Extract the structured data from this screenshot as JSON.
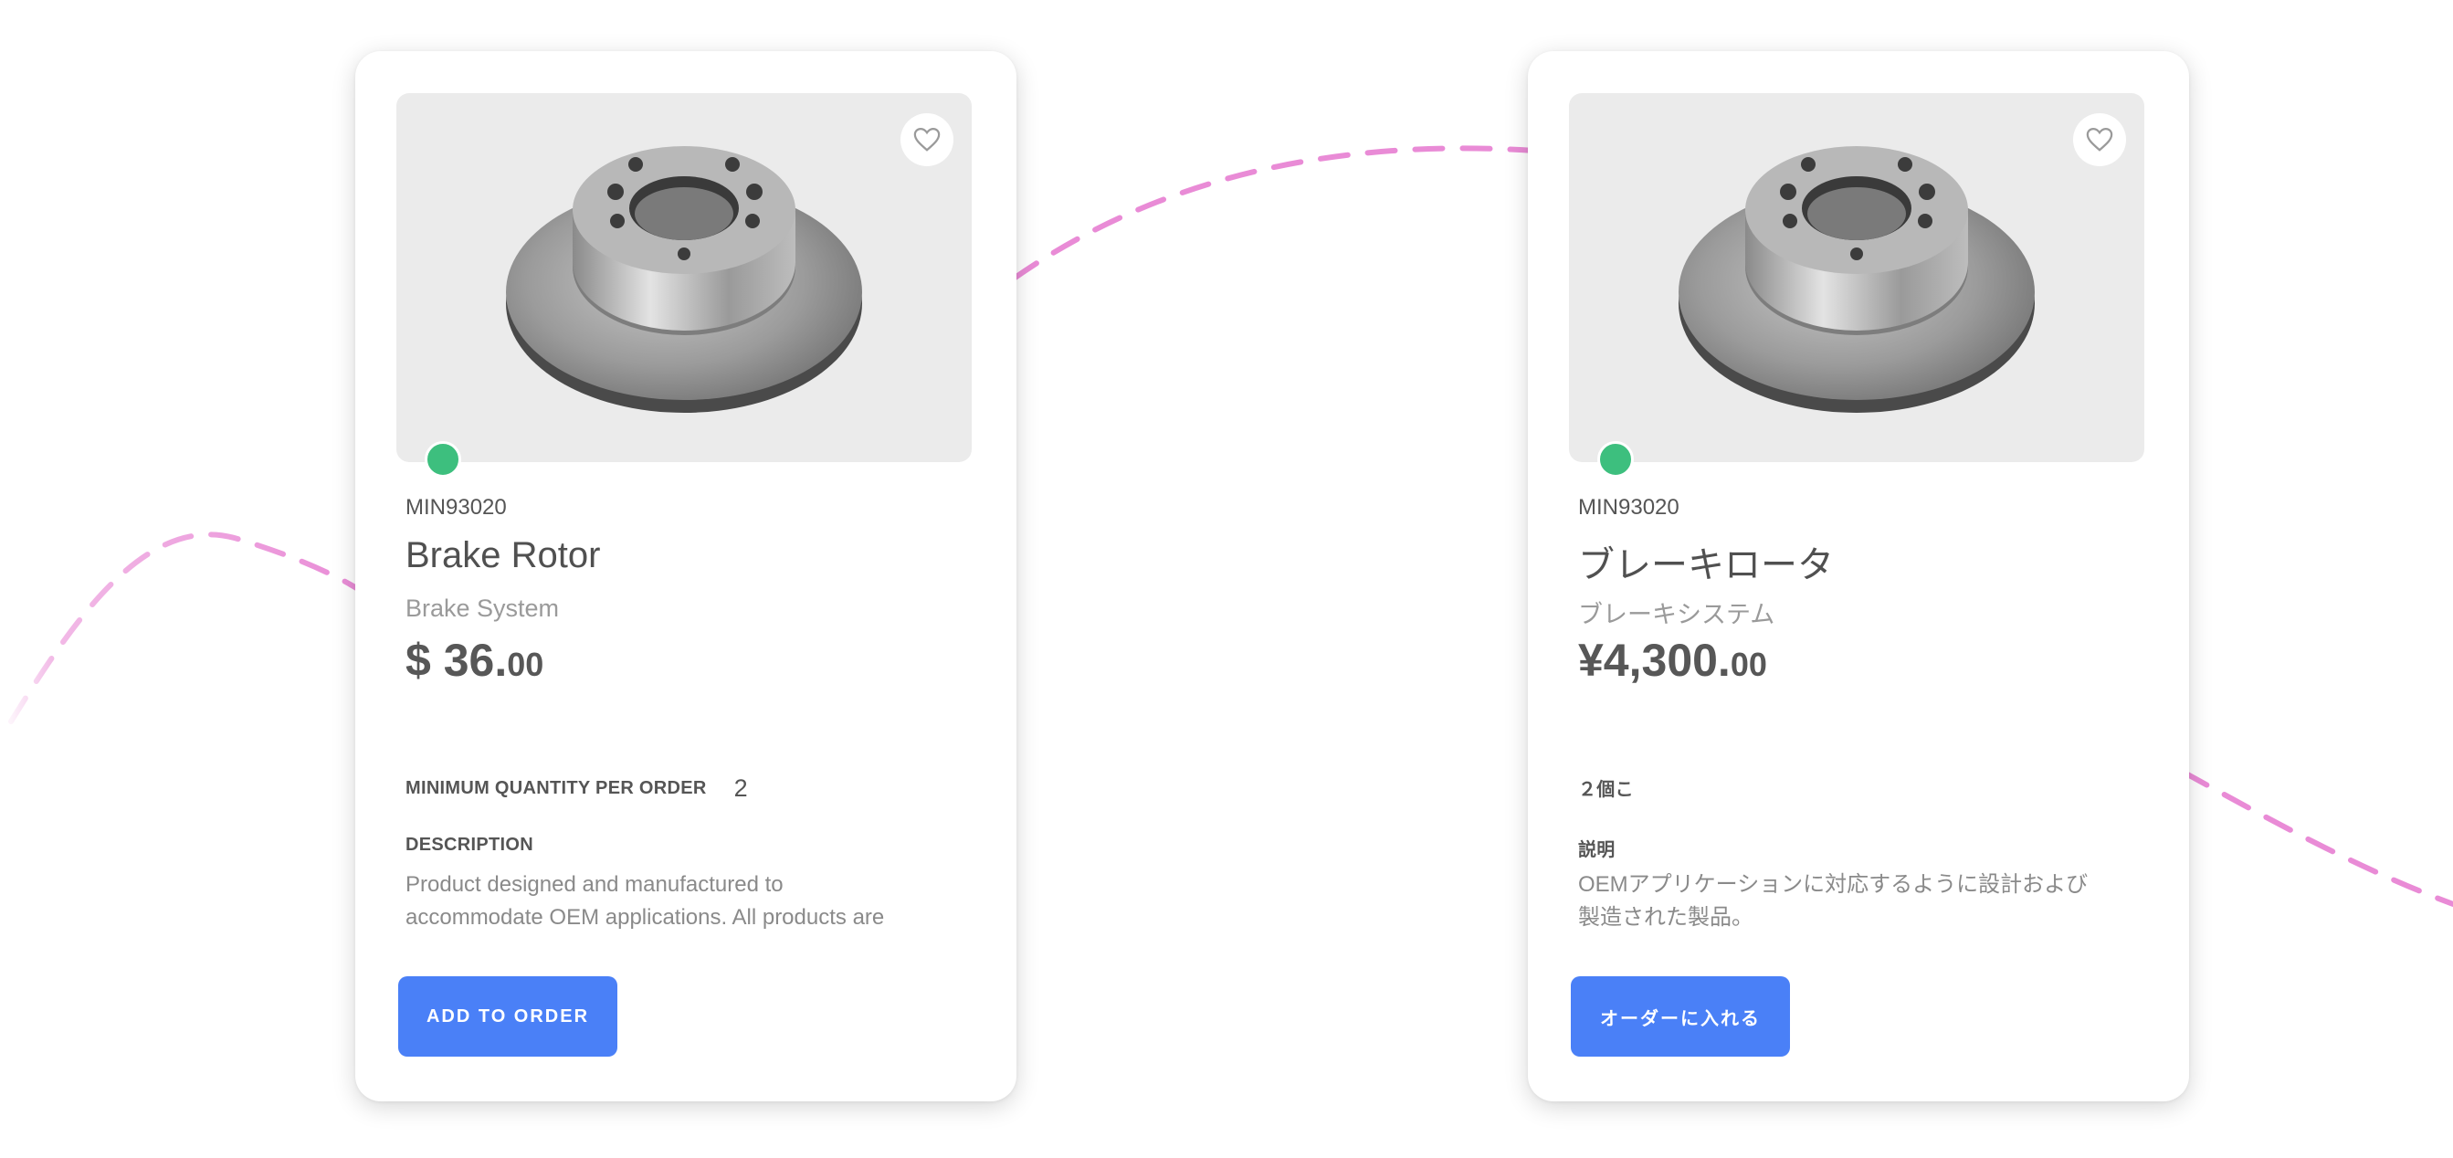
{
  "colors": {
    "accent_button": "#4a80f7",
    "status_green": "#3dbf7e",
    "decor_curve": "#e98bd6"
  },
  "cards": [
    {
      "sku": "MIN93020",
      "name": "Brake Rotor",
      "category": "Brake System",
      "price_main": "$ 36.",
      "price_cents": "00",
      "min_qty_label": "MINIMUM QUANTITY PER ORDER",
      "min_qty_value": "2",
      "description_label": "DESCRIPTION",
      "description": "Product designed and manufactured to accommodate OEM applications. All products are",
      "button_label": "ADD TO ORDER",
      "favorite_icon": "heart-icon",
      "availability_status": "in-stock"
    },
    {
      "sku": "MIN93020",
      "name": "ブレーキロータ",
      "category": "ブレーキシステム",
      "price_main": "¥4,300.",
      "price_cents": "00",
      "min_qty_label": "２個こ",
      "min_qty_value": "",
      "description_label": "説明",
      "description": "OEMアプリケーションに対応するように設計および製造された製品。",
      "button_label": "オーダーに入れる",
      "favorite_icon": "heart-icon",
      "availability_status": "in-stock"
    }
  ]
}
